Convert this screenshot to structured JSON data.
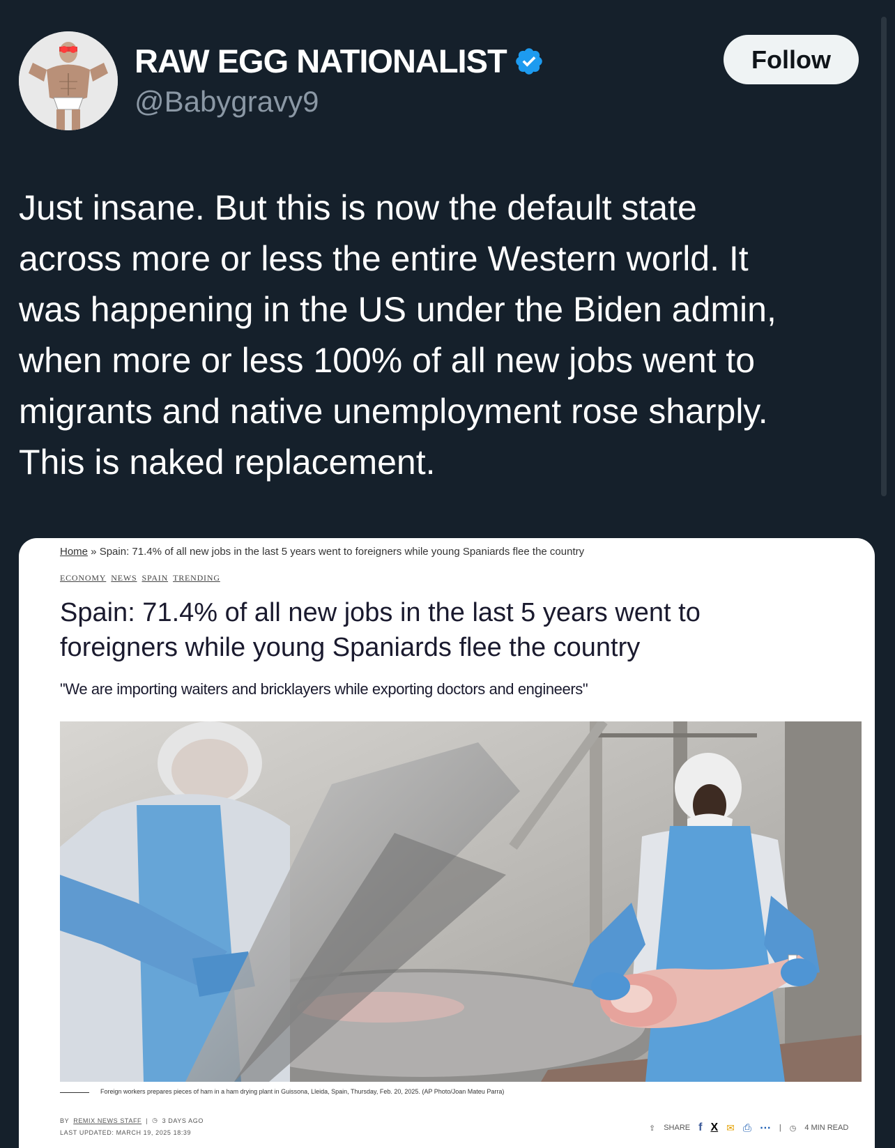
{
  "author": {
    "display_name": "RAW EGG NATIONALIST",
    "handle": "@Babygravy9",
    "avatar_icon": "bodybuilder-avatar",
    "verified_icon": "verified-badge-icon"
  },
  "follow_button": {
    "label": "Follow"
  },
  "tweet": {
    "lines": [
      "Just insane. But this is now the default state",
      "across more or less the entire Western world. It",
      "was happening in the US under the Biden admin,",
      "when more or less 100% of all new jobs went to",
      "migrants and native unemployment rose sharply.",
      "This is naked replacement."
    ]
  },
  "article": {
    "breadcrumb_home": "Home",
    "breadcrumb_sep": " » ",
    "breadcrumb_current": "Spain: 71.4% of all new jobs in the last 5 years went to foreigners while young Spaniards flee the country",
    "categories": [
      "ECONOMY",
      "NEWS",
      "SPAIN",
      "TRENDING"
    ],
    "headline_lines": [
      "Spain: 71.4% of all new jobs in the last 5 years went to",
      "foreigners while young Spaniards flee the country"
    ],
    "subtitle": "\"We are importing waiters and bricklayers while exporting doctors and engineers\"",
    "caption": "Foreign workers prepares pieces of ham in a ham drying plant in Guissona, Lleida, Spain, Thursday, Feb. 20, 2025. (AP Photo/Joan Mateu Parra)",
    "by_prefix": "BY",
    "author": "REMIX NEWS STAFF",
    "time_ago": "3 DAYS AGO",
    "last_updated": "LAST UPDATED: MARCH 19, 2025 18:39",
    "share_label": "SHARE",
    "read_time": "4 MIN READ",
    "colors": {
      "headline": "#1a1a2e",
      "apron": "#5a9fd6"
    }
  }
}
